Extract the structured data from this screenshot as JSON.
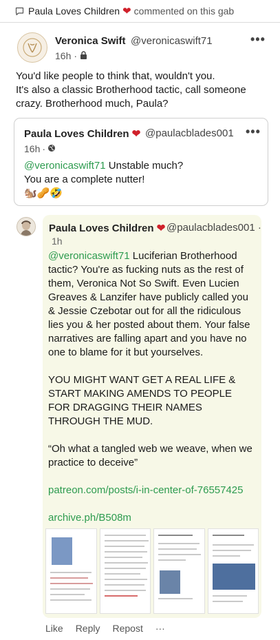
{
  "header": {
    "user_name": "Paula Loves Children",
    "heart": "❤",
    "action_text": "commented on this gab"
  },
  "post": {
    "author_name": "Veronica Swift",
    "author_handle": "@veronicaswift71",
    "time": "16h",
    "privacy_icon": "lock-icon",
    "menu_glyph": "•••",
    "text_line1": "You'd like people to think that, wouldn't you.",
    "text_line2": "It's also a classic Brotherhood tactic, call someone crazy. Brotherhood much, Paula?"
  },
  "quote": {
    "author_name": "Paula Loves Children",
    "heart": "❤",
    "author_handle": "@paulacblades001",
    "time": "16h",
    "sep": "·",
    "privacy_icon": "globe-icon",
    "menu_glyph": "•••",
    "mention": "@veronicaswift71",
    "text_rest": " Unstable much?",
    "text_line2": "You are a complete nutter!",
    "emojis": "🐿️🥜🤣"
  },
  "reply": {
    "author_name": "Paula Loves Children",
    "heart": "❤",
    "author_handle": "@paulacblades001",
    "dot": "·",
    "time": "1h",
    "mention": "@veronicaswift71",
    "para1_rest": " Luciferian Brotherhood tactic? You're as fucking nuts as the rest of them, Veronica Not So Swift. Even Lucien Greaves & Lanzifer have publicly called you & Jessie Czebotar out for all the ridiculous lies you & her posted about them. Your false narratives are falling apart and you have no one to blame for it but yourselves.",
    "para2": "YOU MIGHT WANT GET A REAL LIFE & START MAKING AMENDS TO PEOPLE FOR DRAGGING THEIR NAMES THROUGH THE MUD.",
    "para3": "“Oh what a tangled web we weave, when we practice to deceive”",
    "link1": "patreon.com/posts/i-in-center-of-76557425",
    "link2": "archive.ph/B508m"
  },
  "actions": {
    "like": "Like",
    "reply": "Reply",
    "repost": "Repost",
    "more": "···"
  },
  "colors": {
    "accent_green": "#2d9b4f",
    "heart_red": "#d0202a",
    "reply_bg": "#f7f8e7"
  }
}
